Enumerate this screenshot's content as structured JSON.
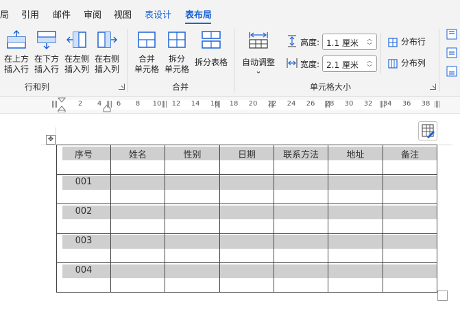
{
  "tabs": [
    "局",
    "引用",
    "邮件",
    "审阅",
    "视图",
    "表设计",
    "表布局"
  ],
  "ribbon": {
    "rows_cols": {
      "insert_above": [
        "在上方",
        "插入行"
      ],
      "insert_below": [
        "在下方",
        "插入行"
      ],
      "insert_left": [
        "在左侧",
        "插入列"
      ],
      "insert_right": [
        "在右侧",
        "插入列"
      ],
      "label": "行和列"
    },
    "merge": {
      "merge_cells": [
        "合并",
        "单元格"
      ],
      "split_cells": [
        "拆分",
        "单元格"
      ],
      "split_table": "拆分表格",
      "label": "合并"
    },
    "cell_size": {
      "autofit": "自动调整",
      "autofit_arrow": "⌄",
      "height_label": "高度:",
      "height_value": "1.1 厘米",
      "width_label": "宽度:",
      "width_value": "2.1 厘米",
      "distribute_rows": "分布行",
      "distribute_cols": "分布列",
      "label": "单元格大小"
    }
  },
  "ruler": {
    "ticks": [
      "2",
      "4",
      "6",
      "8",
      "10",
      "12",
      "14",
      "16",
      "18",
      "20",
      "22",
      "24",
      "26",
      "28",
      "30",
      "32",
      "34",
      "36",
      "38"
    ]
  },
  "table": {
    "headers": [
      "序号",
      "姓名",
      "性别",
      "日期",
      "联系方法",
      "地址",
      "备注"
    ],
    "rows": [
      [
        "001",
        "",
        "",
        "",
        "",
        "",
        ""
      ],
      [
        "002",
        "",
        "",
        "",
        "",
        "",
        ""
      ],
      [
        "003",
        "",
        "",
        "",
        "",
        "",
        ""
      ],
      [
        "004",
        "",
        "",
        "",
        "",
        "",
        ""
      ]
    ]
  },
  "colors": {
    "accent": "#1b63d6",
    "shading": "#cfcfcf"
  }
}
